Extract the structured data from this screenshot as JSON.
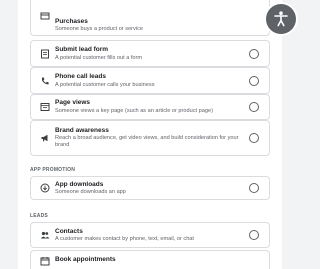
{
  "goals": [
    {
      "title": "Purchases",
      "description": "Someone buys a product or service",
      "icon": "storefront-icon"
    },
    {
      "title": "Submit lead form",
      "description": "A potential customer fills out a form",
      "icon": "form-icon"
    },
    {
      "title": "Phone call leads",
      "description": "A potential customer calls your business",
      "icon": "phone-icon"
    },
    {
      "title": "Page views",
      "description": "Someone views a key page (such as an article or product page)",
      "icon": "web-page-icon"
    },
    {
      "title": "Brand awareness",
      "description": "Reach a broad audience, get video views, and build consideration for your brand",
      "icon": "megaphone-icon"
    }
  ],
  "sections": {
    "app_promotion": {
      "label": "APP PROMOTION",
      "goals": [
        {
          "title": "App downloads",
          "description": "Someone downloads an app",
          "icon": "download-icon"
        }
      ]
    },
    "leads": {
      "label": "LEADS",
      "goals": [
        {
          "title": "Contacts",
          "description": "A customer makes contact by phone, text, email, or chat",
          "icon": "contacts-icon"
        },
        {
          "title": "Book appointments",
          "description": "",
          "icon": "calendar-icon"
        }
      ]
    }
  },
  "colors": {
    "border": "#dadce0",
    "text_secondary": "#5f6368",
    "background": "#f1f3f4"
  },
  "floating_button_icon": "accessibility-icon"
}
